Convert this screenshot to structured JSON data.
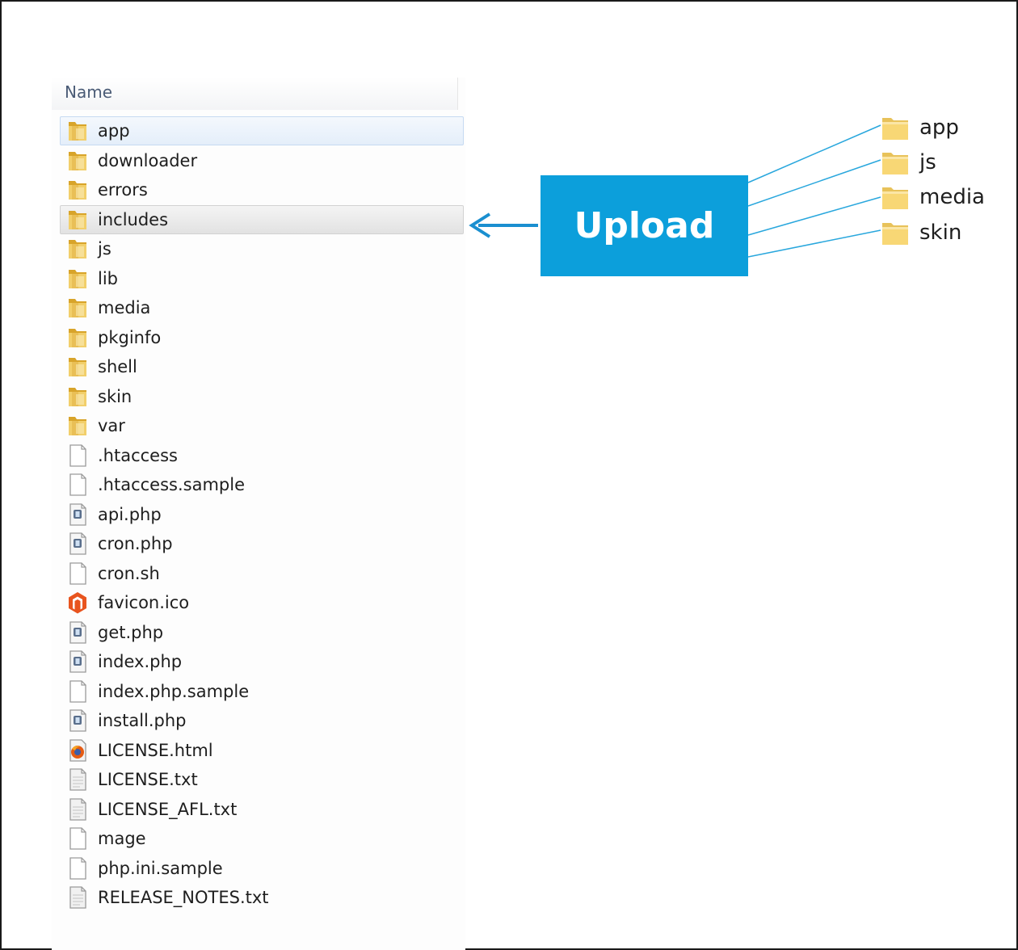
{
  "explorer": {
    "column_header": "Name",
    "items": [
      {
        "name": "app",
        "type": "folder",
        "state": "selected"
      },
      {
        "name": "downloader",
        "type": "folder"
      },
      {
        "name": "errors",
        "type": "folder"
      },
      {
        "name": "includes",
        "type": "folder",
        "state": "hover"
      },
      {
        "name": "js",
        "type": "folder"
      },
      {
        "name": "lib",
        "type": "folder"
      },
      {
        "name": "media",
        "type": "folder"
      },
      {
        "name": "pkginfo",
        "type": "folder"
      },
      {
        "name": "shell",
        "type": "folder"
      },
      {
        "name": "skin",
        "type": "folder"
      },
      {
        "name": "var",
        "type": "folder"
      },
      {
        "name": ".htaccess",
        "type": "file"
      },
      {
        "name": ".htaccess.sample",
        "type": "file"
      },
      {
        "name": "api.php",
        "type": "php"
      },
      {
        "name": "cron.php",
        "type": "php"
      },
      {
        "name": "cron.sh",
        "type": "file"
      },
      {
        "name": "favicon.ico",
        "type": "magento"
      },
      {
        "name": "get.php",
        "type": "php"
      },
      {
        "name": "index.php",
        "type": "php"
      },
      {
        "name": "index.php.sample",
        "type": "file"
      },
      {
        "name": "install.php",
        "type": "php"
      },
      {
        "name": "LICENSE.html",
        "type": "html"
      },
      {
        "name": "LICENSE.txt",
        "type": "txt"
      },
      {
        "name": "LICENSE_AFL.txt",
        "type": "txt"
      },
      {
        "name": "mage",
        "type": "file"
      },
      {
        "name": "php.ini.sample",
        "type": "file"
      },
      {
        "name": "RELEASE_NOTES.txt",
        "type": "txt"
      }
    ]
  },
  "upload": {
    "label": "Upload"
  },
  "upload_folders": [
    "app",
    "js",
    "media",
    "skin"
  ],
  "colors": {
    "upload_bg": "#0c9fdb",
    "arrow": "#1a8fd0",
    "connector": "#29a7dd",
    "folder_yellow": "#f8d775"
  }
}
